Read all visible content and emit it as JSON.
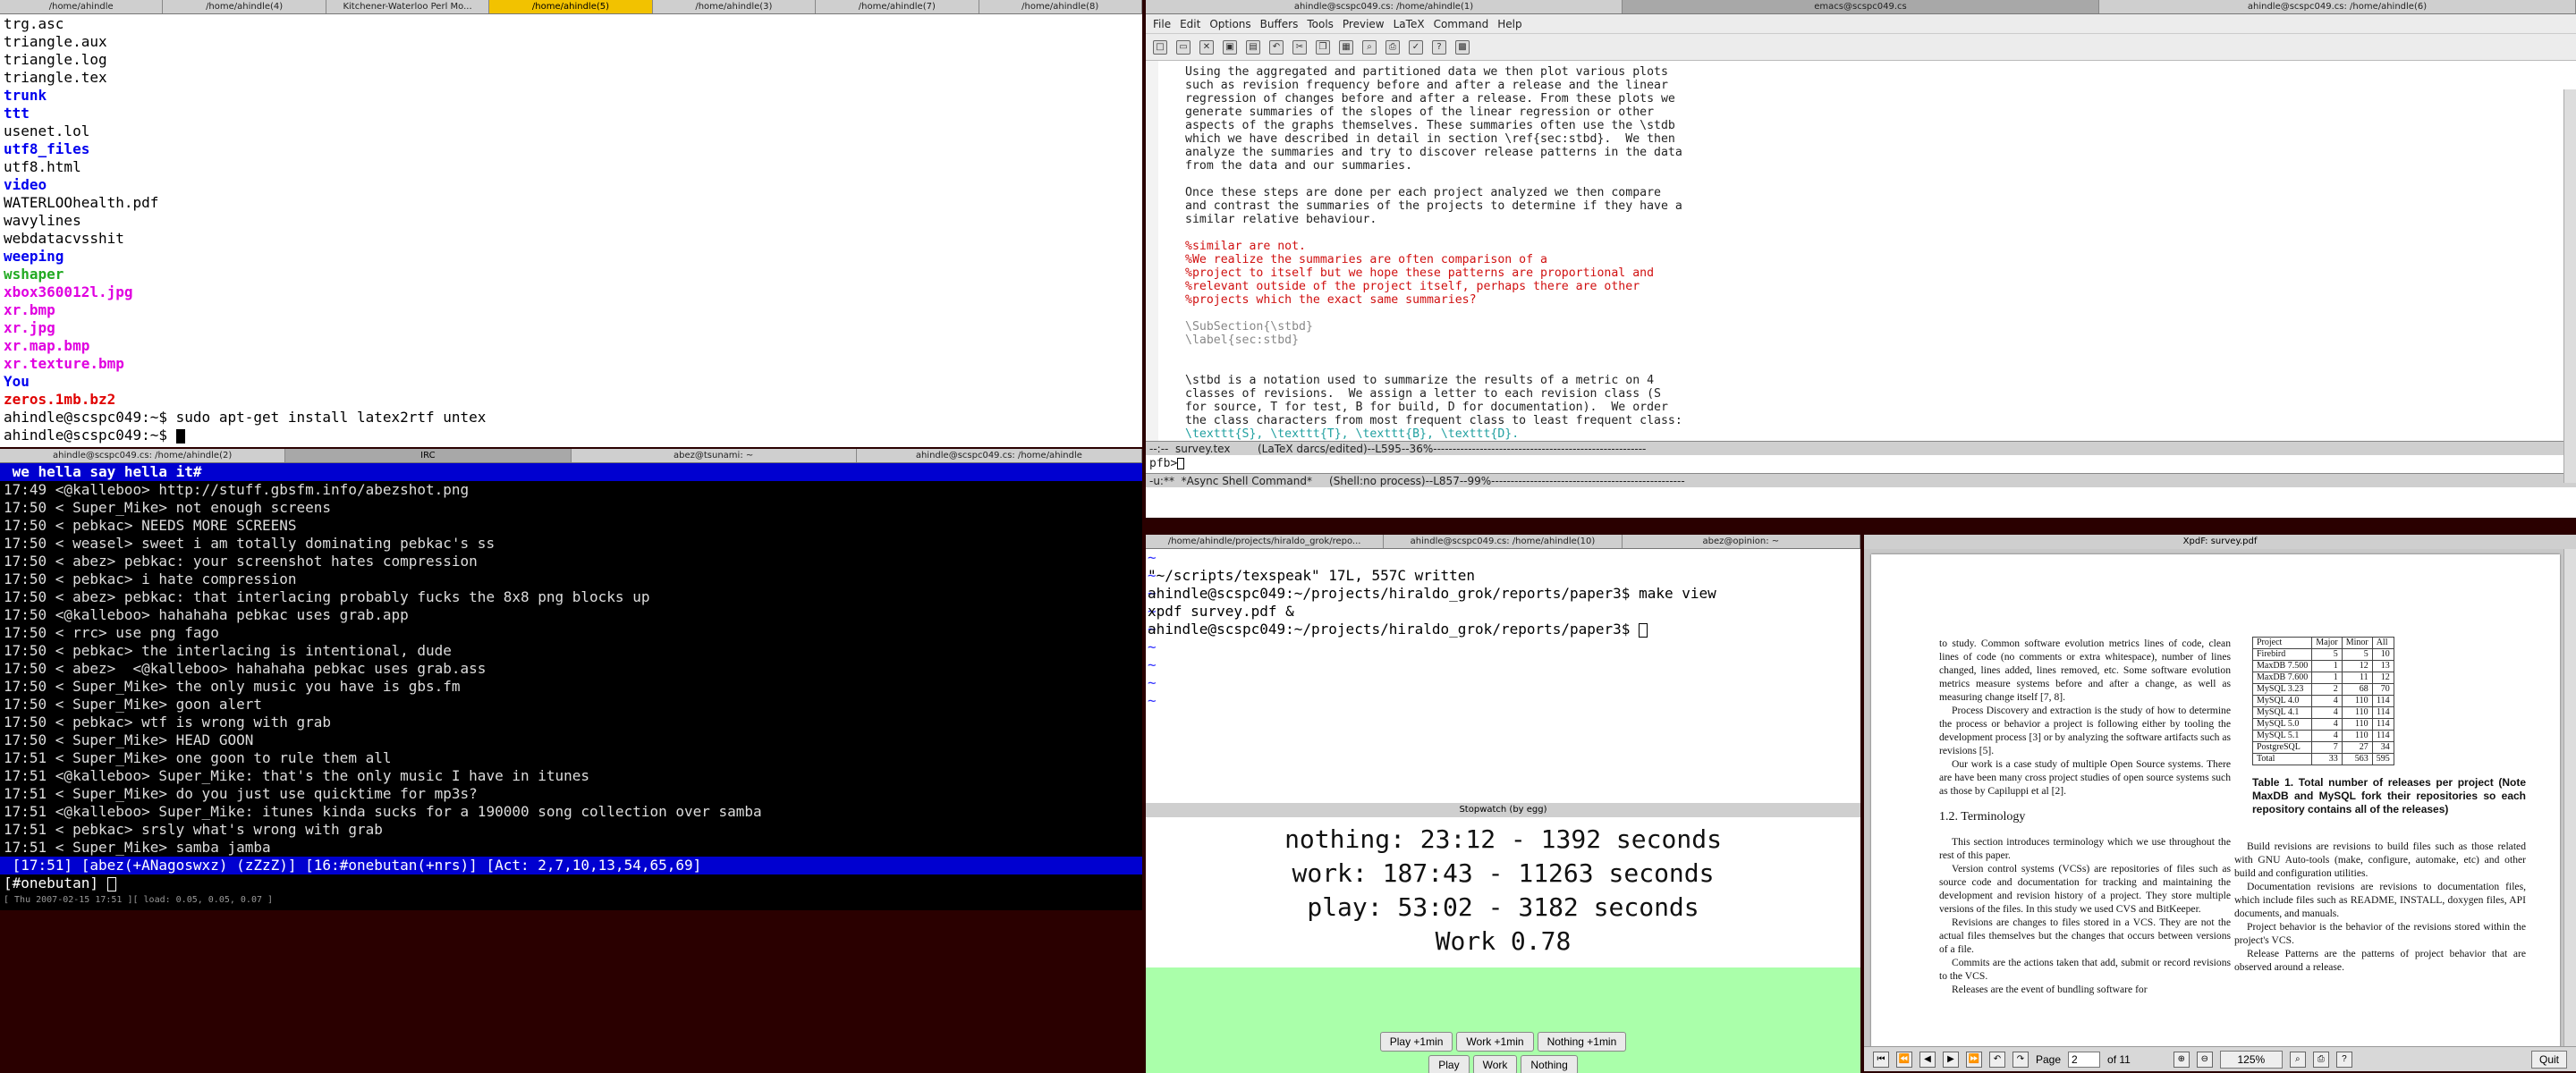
{
  "top_tabs": [
    "/home/ahindle",
    "/home/ahindle(4)",
    "Kitchener-Waterloo Perl Mo...",
    "/home/ahindle(5)",
    "/home/ahindle(3)",
    "/home/ahindle(7)",
    "/home/ahindle(8)"
  ],
  "right_tabs": [
    "ahindle@scspc049.cs: /home/ahindle(1)",
    "emacs@scspc049.cs",
    "ahindle@scspc049.cs: /home/ahindle(6)"
  ],
  "term1": {
    "lines": [
      {
        "t": "trg.asc",
        "c": ""
      },
      {
        "t": "triangle.aux",
        "c": ""
      },
      {
        "t": "triangle.log",
        "c": ""
      },
      {
        "t": "triangle.tex",
        "c": ""
      },
      {
        "t": "trunk",
        "c": "c-blue bold"
      },
      {
        "t": "ttt",
        "c": "c-blue bold"
      },
      {
        "t": "usenet.lol",
        "c": ""
      },
      {
        "t": "utf8_files",
        "c": "c-blue bold"
      },
      {
        "t": "utf8.html",
        "c": ""
      },
      {
        "t": "video",
        "c": "c-blue bold"
      },
      {
        "t": "WATERLOOhealth.pdf",
        "c": ""
      },
      {
        "t": "wavylines",
        "c": ""
      },
      {
        "t": "webdatacvsshit",
        "c": ""
      },
      {
        "t": "weeping",
        "c": "c-blue bold"
      },
      {
        "t": "wshaper",
        "c": "c-green bold"
      },
      {
        "t": "xbox360012l.jpg",
        "c": "c-mag bold"
      },
      {
        "t": "xr.bmp",
        "c": "c-mag bold"
      },
      {
        "t": "xr.jpg",
        "c": "c-mag bold"
      },
      {
        "t": "xr.map.bmp",
        "c": "c-mag bold"
      },
      {
        "t": "xr.texture.bmp",
        "c": "c-mag bold"
      },
      {
        "t": "You",
        "c": "c-blue bold"
      },
      {
        "t": "zeros.1mb.bz2",
        "c": "c-red bold"
      },
      {
        "t": "ahindle@scspc049:~$ sudo apt-get install latex2rtf untex",
        "c": ""
      },
      {
        "t": "ahindle@scspc049:~$ ",
        "c": ""
      }
    ]
  },
  "mid_tabs": [
    "ahindle@scspc049.cs: /home/ahindle(2)",
    "IRC",
    "abez@tsunami: ~",
    "ahindle@scspc049.cs: /home/ahindle"
  ],
  "irc": {
    "topic": " we hella say hella it#",
    "lines": [
      "17:49 <@kalleboo> http://stuff.gbsfm.info/abezshot.png",
      "17:50 < Super_Mike> not enough screens",
      "17:50 < pebkac> NEEDS MORE SCREENS",
      "17:50 < weasel> sweet i am totally dominating pebkac's ss",
      "17:50 < abez> pebkac: your screenshot hates compression",
      "17:50 < pebkac> i hate compression",
      "17:50 < abez> pebkac: that interlacing probably fucks the 8x8 png blocks up",
      "17:50 <@kalleboo> hahahaha pebkac uses grab.app",
      "17:50 < rrc> use png fago",
      "17:50 < pebkac> the interlacing is intentional, dude",
      "17:50 < abez>  <@kalleboo> hahahaha pebkac uses grab.ass",
      "17:50 < Super_Mike> the only music you have is gbs.fm",
      "17:50 < Super_Mike> goon alert",
      "17:50 < pebkac> wtf is wrong with grab",
      "17:50 < Super_Mike> HEAD GOON",
      "17:51 < Super_Mike> one goon to rule them all",
      "17:51 <@kalleboo> Super_Mike: that's the only music I have in itunes",
      "17:51 < Super_Mike> do you just use quicktime for mp3s?",
      "17:51 <@kalleboo> Super_Mike: itunes kinda sucks for a 190000 song collection over samba",
      "17:51 < pebkac> srsly what's wrong with grab",
      "17:51 < Super_Mike> samba jamba"
    ],
    "status": " [17:51] [abez(+ANagoswxz) (zZzZ)] [16:#onebutan(+nrs)] [Act: 2,7,10,13,54,65,69]",
    "input": "[#onebutan] ",
    "clock": "[ Thu 2007-02-15 17:51 ][ load: 0.05, 0.05, 0.07 ]"
  },
  "emacs": {
    "menu": [
      "File",
      "Edit",
      "Options",
      "Buffers",
      "Tools",
      "Preview",
      "LaTeX",
      "Command",
      "Help"
    ],
    "lines": [
      {
        "t": "Using the aggregated and partitioned data we then plot various plots",
        "c": ""
      },
      {
        "t": "such as revision frequency before and after a release and the linear",
        "c": ""
      },
      {
        "t": "regression of changes before and after a release. From these plots we",
        "c": ""
      },
      {
        "t": "generate summaries of the slopes of the linear regression or other",
        "c": ""
      },
      {
        "t": "aspects of the graphs themselves. These summaries often use the \\stdb",
        "c": ""
      },
      {
        "t": "which we have described in detail in section \\ref{sec:stbd}.  We then",
        "c": ""
      },
      {
        "t": "analyze the summaries and try to discover release patterns in the data",
        "c": ""
      },
      {
        "t": "from the data and our summaries.",
        "c": ""
      },
      {
        "t": "",
        "c": ""
      },
      {
        "t": "Once these steps are done per each project analyzed we then compare",
        "c": ""
      },
      {
        "t": "and contrast the summaries of the projects to determine if they have a",
        "c": ""
      },
      {
        "t": "similar relative behaviour.",
        "c": ""
      },
      {
        "t": "",
        "c": ""
      },
      {
        "t": "%similar are not.",
        "c": "cmt"
      },
      {
        "t": "%We realize the summaries are often comparison of a",
        "c": "cmt"
      },
      {
        "t": "%project to itself but we hope these patterns are proportional and",
        "c": "cmt"
      },
      {
        "t": "%relevant outside of the project itself, perhaps there are other",
        "c": "cmt"
      },
      {
        "t": "%projects which the exact same summaries?",
        "c": "cmt"
      },
      {
        "t": "",
        "c": ""
      },
      {
        "t": "\\SubSection{\\stbd}",
        "c": "cmd"
      },
      {
        "t": "\\label{sec:stbd}",
        "c": "cmd"
      },
      {
        "t": "",
        "c": ""
      },
      {
        "t": "",
        "c": ""
      },
      {
        "t": "\\stbd is a notation used to summarize the results of a metric on 4",
        "c": ""
      },
      {
        "t": "classes of revisions.  We assign a letter to each revision class (S",
        "c": ""
      },
      {
        "t": "for source, T for test, B for build, D for documentation).  We order",
        "c": ""
      },
      {
        "t": "the class characters from most frequent class to least frequent class:",
        "c": ""
      },
      {
        "t": "\\texttt{S}, \\texttt{T}, \\texttt{B}, \\texttt{D}.",
        "c": "arg"
      }
    ],
    "modeline1": "--:--  survey.tex        (LaTeX darcs/edited)--L595--36%-------------------------------------------------------",
    "mini": "pfb>",
    "modeline2": "-u:**  *Async Shell Command*     (Shell:no process)--L857--99%--------------------------------------------------"
  },
  "lower_tabs": [
    "/home/ahindle/projects/hiraldo_grok/repo...",
    "ahindle@scspc049.cs: /home/ahindle(10)",
    "abez@opinion: ~"
  ],
  "vim": {
    "tildes": 9,
    "lines": [
      "\"~/scripts/texspeak\" 17L, 557C written",
      "ahindle@scspc049:~/projects/hiraldo_grok/reports/paper3$ make view",
      "xpdf survey.pdf &",
      "ahindle@scspc049:~/projects/hiraldo_grok/reports/paper3$ "
    ]
  },
  "stopwatch": {
    "title": "Stopwatch (by egg)",
    "lines": [
      "nothing: 23:12 - 1392 seconds",
      "work: 187:43 - 11263 seconds",
      "play: 53:02 - 3182 seconds",
      "Work 0.78"
    ],
    "buttons_top": [
      "Play +1min",
      "Work +1min",
      "Nothing +1min"
    ],
    "buttons_bottom": [
      "Play",
      "Work",
      "Nothing"
    ],
    "accent": "#aaffaa"
  },
  "xpdf": {
    "title": "XpdF: survey.pdf",
    "left_paras": [
      "to study.     Common software evolution metrics lines of code, clean lines of code (no comments or extra whitespace), number of lines changed, lines added, lines removed, etc.  Some software evolution metrics measure systems before and after a change, as well as measuring change itself [7, 8].",
      "Process Discovery and extraction is the study of how to determine the process or behavior a project is following either by tooling the development process [3] or by analyzing the software artifacts such as revisions [5].",
      "Our work is a case study of multiple Open Source systems. There are have been many cross project studies of open source systems such as those by Capiluppi et al [2]."
    ],
    "section": "1.2. Terminology",
    "left_paras2": [
      "This section introduces terminology which we use throughout the rest of this paper.",
      "Version control systems (VCSs) are repositories of files such as source code and documentation for tracking and maintaining the development and revision history of a project. They store multiple versions of the files. In this study we used CVS and BitKeeper.",
      "Revisions are changes to files stored in a VCS. They are not the actual files themselves but the changes that occurs between versions of a file.",
      "Commits are the actions taken that add, submit or record revisions to the VCS.",
      "Releases are the event of bundling software for"
    ],
    "table_head": [
      "Project",
      "Major",
      "Minor",
      "All"
    ],
    "table_rows": [
      [
        "Firebird",
        "5",
        "5",
        "10"
      ],
      [
        "MaxDB 7.500",
        "1",
        "12",
        "13"
      ],
      [
        "MaxDB 7.600",
        "1",
        "11",
        "12"
      ],
      [
        "MySQL 3.23",
        "2",
        "68",
        "70"
      ],
      [
        "MySQL 4.0",
        "4",
        "110",
        "114"
      ],
      [
        "MySQL 4.1",
        "4",
        "110",
        "114"
      ],
      [
        "MySQL 5.0",
        "4",
        "110",
        "114"
      ],
      [
        "MySQL 5.1",
        "4",
        "110",
        "114"
      ],
      [
        "PostgreSQL",
        "7",
        "27",
        "34"
      ],
      [
        "Total",
        "33",
        "563",
        "595"
      ]
    ],
    "caption": "Table 1. Total number of releases per project (Note MaxDB and MySQL fork their repositories so each repository contains all of the releases)",
    "right_paras": [
      "Build revisions are revisions to build files such as those related with GNU Auto-tools (make, configure, automake, etc) and other build and configuration utilities.",
      "Documentation revisions are revisions to documentation files, which include files such as README, INSTALL, doxygen files, API documents, and manuals.",
      "Project behavior is the behavior of the revisions stored within the project's VCS.",
      "Release Patterns are the patterns of project behavior that are observed around a release."
    ],
    "page_label": "Page",
    "page": "2",
    "of": "of 11",
    "zoom": "125%",
    "quit": "Quit"
  }
}
